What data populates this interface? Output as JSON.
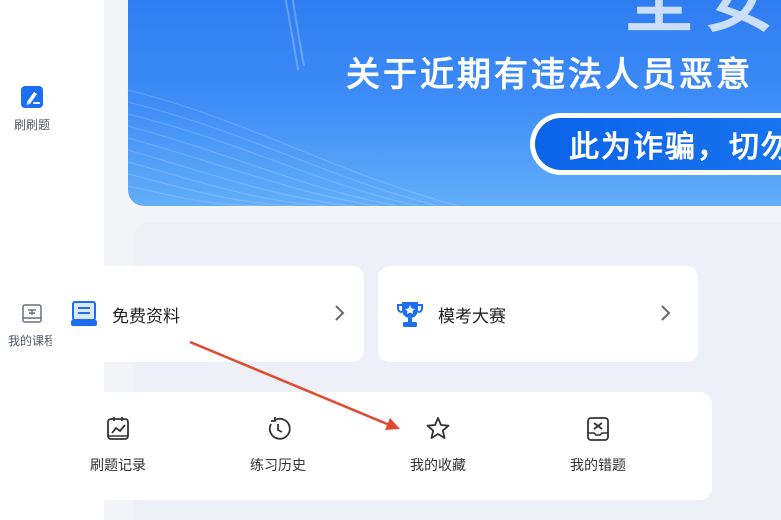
{
  "sidebar": {
    "items": [
      {
        "label": "刷刷题",
        "icon": "brush-question-icon"
      },
      {
        "label": "我的课程",
        "icon": "course-book-icon"
      }
    ]
  },
  "banner": {
    "big_text": "全安",
    "title": "关于近期有违法人员恶意",
    "pill_text": "此为诈骗，切勿"
  },
  "quick_cards": {
    "free": {
      "label": "免费资料",
      "icon": "document-box-icon"
    },
    "exam": {
      "label": "模考大赛",
      "icon": "trophy-icon"
    }
  },
  "tools": {
    "items": [
      {
        "label": "刷题记录",
        "icon": "chart-record-icon"
      },
      {
        "label": "练习历史",
        "icon": "history-clock-icon"
      },
      {
        "label": "我的收藏",
        "icon": "star-icon"
      },
      {
        "label": "我的错题",
        "icon": "wrong-question-icon"
      }
    ]
  },
  "colors": {
    "accent": "#1c6ef2",
    "annotation_arrow": "#e04a30"
  }
}
